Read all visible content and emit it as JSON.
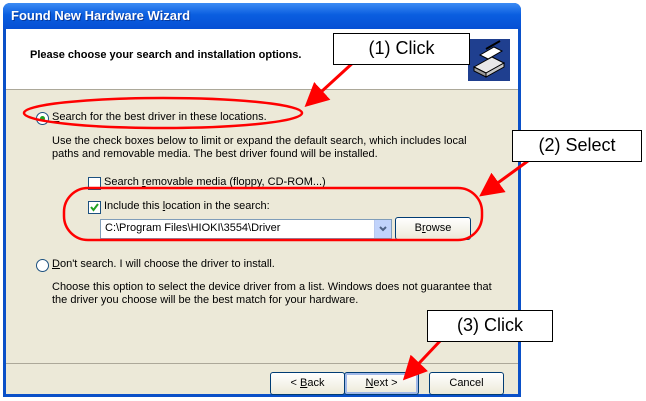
{
  "window": {
    "title": "Found New Hardware Wizard"
  },
  "header": {
    "title": "Please choose your search and installation options."
  },
  "option_search": {
    "label_prefix": "",
    "label_underlined": "S",
    "label_rest": "earch for the best driver in these locations.",
    "selected": true,
    "description_line1": "Use the check boxes below to limit or expand the default search, which includes local",
    "description_line2": "paths and removable media. The best driver found will be installed."
  },
  "check_removable": {
    "label_prefix": "Search ",
    "label_underlined": "r",
    "label_rest": "emovable media (floppy, CD-ROM...)",
    "checked": false
  },
  "check_location": {
    "label_prefix": "Include this ",
    "label_underlined": "l",
    "label_rest": "ocation in the search:",
    "checked": true
  },
  "path_combo": {
    "value": "C:\\Program Files\\HIOKI\\3554\\Driver"
  },
  "browse_button": {
    "label_prefix": "B",
    "label_underlined": "r",
    "label_rest": "owse"
  },
  "option_dont": {
    "label_prefix": "",
    "label_underlined": "D",
    "label_rest": "on't search. I will choose the driver to install.",
    "selected": false,
    "description_line1": "Choose this option to select the device driver from a list.  Windows does not guarantee that",
    "description_line2": "the driver you choose will be the best match for your hardware."
  },
  "footer": {
    "back_prefix": "< ",
    "back_underlined": "B",
    "back_rest": "ack",
    "next_prefix": "",
    "next_underlined": "N",
    "next_rest": "ext >",
    "cancel_label": "Cancel"
  },
  "callouts": {
    "click1": "(1) Click",
    "select2": "(2) Select",
    "click3": "(3) Click"
  },
  "colors": {
    "title_bar": "#0a5ee0",
    "annotation": "#ff0000",
    "client_bg": "#ece9d8"
  }
}
